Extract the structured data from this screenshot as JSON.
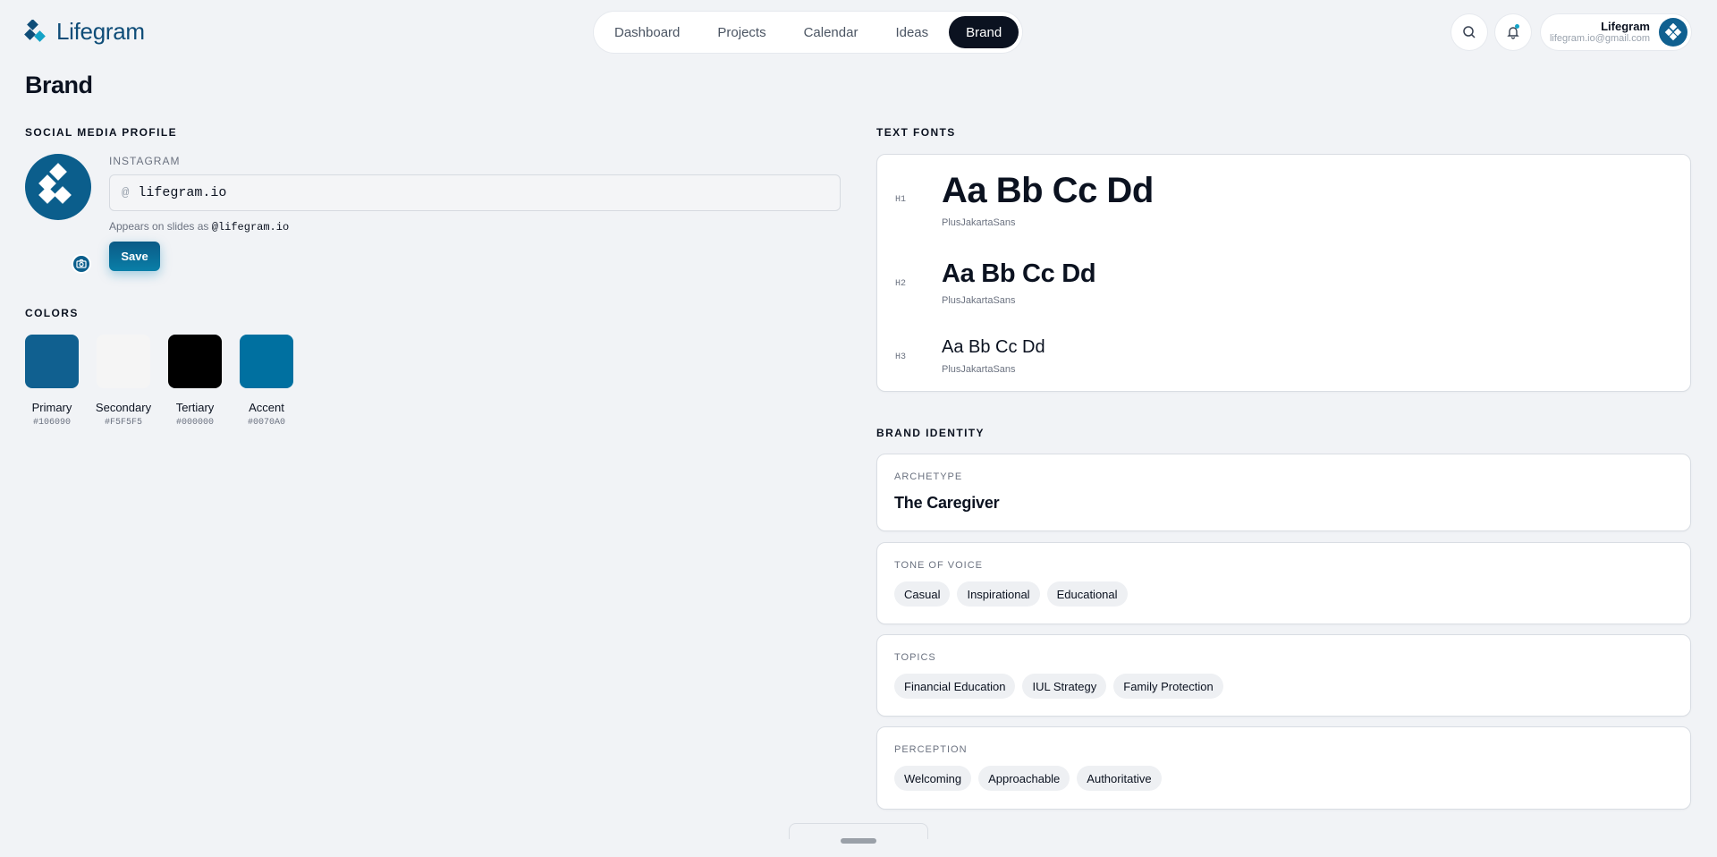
{
  "app": {
    "name": "Lifegram"
  },
  "nav": {
    "items": [
      {
        "label": "Dashboard",
        "active": false
      },
      {
        "label": "Projects",
        "active": false
      },
      {
        "label": "Calendar",
        "active": false
      },
      {
        "label": "Ideas",
        "active": false
      },
      {
        "label": "Brand",
        "active": true
      }
    ]
  },
  "header": {
    "search_icon": "search-icon",
    "bell_icon": "bell-icon",
    "user": {
      "name": "Lifegram",
      "email": "lifegram.io@gmail.com"
    }
  },
  "page": {
    "title": "Brand"
  },
  "social": {
    "section_label": "SOCIAL MEDIA PROFILE",
    "field_label": "INSTAGRAM",
    "at_prefix": "@",
    "handle_value": "lifegram.io",
    "helper_prefix": "Appears on slides as",
    "helper_handle": "@lifegram.io",
    "save_label": "Save"
  },
  "colors": {
    "section_label": "COLORS",
    "items": [
      {
        "name": "Primary",
        "hex": "#106090"
      },
      {
        "name": "Secondary",
        "hex": "#F5F5F5"
      },
      {
        "name": "Tertiary",
        "hex": "#000000"
      },
      {
        "name": "Accent",
        "hex": "#0070A0"
      }
    ]
  },
  "fonts": {
    "section_label": "TEXT FONTS",
    "items": [
      {
        "tag": "H1",
        "sample": "Aa Bb Cc Dd",
        "font": "PlusJakartaSans"
      },
      {
        "tag": "H2",
        "sample": "Aa Bb Cc Dd",
        "font": "PlusJakartaSans"
      },
      {
        "tag": "H3",
        "sample": "Aa Bb Cc Dd",
        "font": "PlusJakartaSans"
      }
    ]
  },
  "identity": {
    "section_label": "BRAND IDENTITY",
    "archetype": {
      "label": "ARCHETYPE",
      "value": "The Caregiver"
    },
    "tone": {
      "label": "TONE OF VOICE",
      "chips": [
        "Casual",
        "Inspirational",
        "Educational"
      ]
    },
    "topics": {
      "label": "TOPICS",
      "chips": [
        "Financial Education",
        "IUL Strategy",
        "Family Protection"
      ]
    },
    "perception": {
      "label": "PERCEPTION",
      "chips": [
        "Welcoming",
        "Approachable",
        "Authoritative"
      ]
    }
  }
}
